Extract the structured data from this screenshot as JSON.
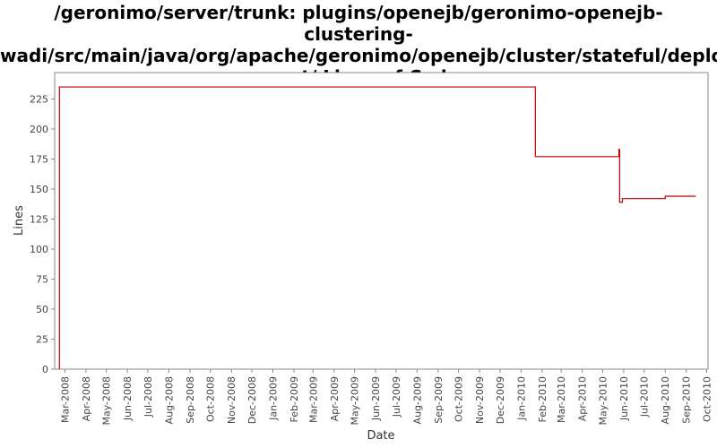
{
  "chart_data": {
    "type": "line",
    "title_lines": [
      "/geronimo/server/trunk: plugins/openejb/geronimo-openejb-clustering-",
      "wadi/src/main/java/org/apache/geronimo/openejb/cluster/stateful/deploy",
      "ment/ Lines of Code"
    ],
    "xlabel": "Date",
    "ylabel": "Lines",
    "ylim": [
      0,
      247
    ],
    "y_ticks": [
      0,
      25,
      50,
      75,
      100,
      125,
      150,
      175,
      200,
      225
    ],
    "x_range": [
      "2008-02-15",
      "2010-10-03"
    ],
    "x_ticks": [
      "Mar-2008",
      "Apr-2008",
      "May-2008",
      "Jun-2008",
      "Jul-2008",
      "Aug-2008",
      "Sep-2008",
      "Oct-2008",
      "Nov-2008",
      "Dec-2008",
      "Jan-2009",
      "Feb-2009",
      "Mar-2009",
      "Apr-2009",
      "May-2009",
      "Jun-2009",
      "Jul-2009",
      "Aug-2009",
      "Sep-2009",
      "Oct-2009",
      "Nov-2009",
      "Dec-2009",
      "Jan-2010",
      "Feb-2010",
      "Mar-2010",
      "Apr-2010",
      "May-2010",
      "Jun-2010",
      "Jul-2010",
      "Aug-2010",
      "Sep-2010",
      "Oct-2010"
    ],
    "x_tick_dates": [
      "2008-03-01",
      "2008-04-01",
      "2008-05-01",
      "2008-06-01",
      "2008-07-01",
      "2008-08-01",
      "2008-09-01",
      "2008-10-01",
      "2008-11-01",
      "2008-12-01",
      "2009-01-01",
      "2009-02-01",
      "2009-03-01",
      "2009-04-01",
      "2009-05-01",
      "2009-06-01",
      "2009-07-01",
      "2009-08-01",
      "2009-09-01",
      "2009-10-01",
      "2009-11-01",
      "2009-12-01",
      "2010-01-01",
      "2010-02-01",
      "2010-03-01",
      "2010-04-01",
      "2010-05-01",
      "2010-06-01",
      "2010-07-01",
      "2010-08-01",
      "2010-09-01",
      "2010-10-01"
    ],
    "grid": false,
    "series": [
      {
        "color": "#c00000",
        "step": true,
        "points": [
          {
            "x": "2008-02-22",
            "y": 0
          },
          {
            "x": "2008-02-22",
            "y": 235
          },
          {
            "x": "2010-01-22",
            "y": 177
          },
          {
            "x": "2010-05-25",
            "y": 183
          },
          {
            "x": "2010-05-26",
            "y": 139
          },
          {
            "x": "2010-05-30",
            "y": 142
          },
          {
            "x": "2010-08-01",
            "y": 144
          },
          {
            "x": "2010-09-15",
            "y": 144
          }
        ]
      }
    ]
  }
}
